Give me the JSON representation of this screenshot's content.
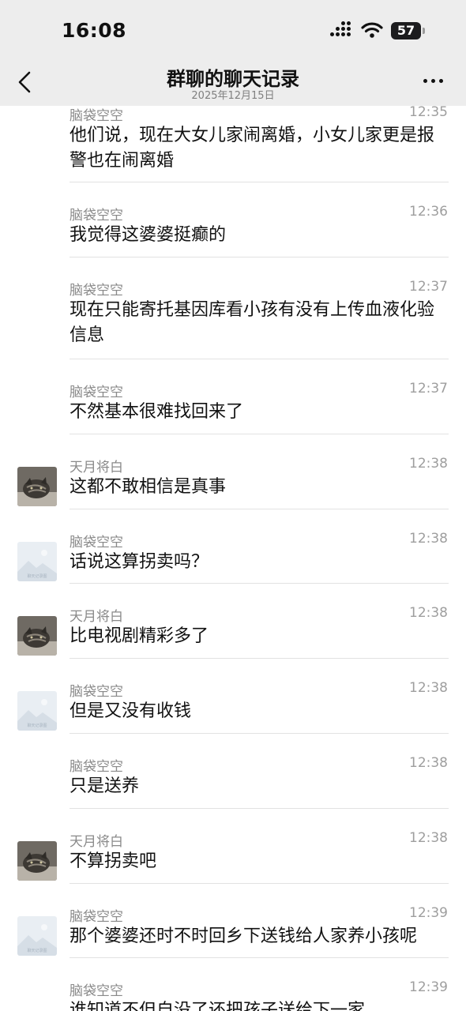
{
  "status_bar": {
    "time": "16:08",
    "battery": "57"
  },
  "header": {
    "title": "群聊的聊天记录",
    "date": "2025年12月15日"
  },
  "avatars": {
    "cat": {
      "icon": "cat-photo-avatar",
      "bg": "#4f4a44"
    },
    "placeholder": {
      "icon": "landscape-placeholder-avatar",
      "bg": "#e9eef3",
      "caption": "聊天记录图"
    }
  },
  "colors": {
    "header_bg": "#ededed",
    "divider": "#e2e2e2",
    "meta_text": "#8a8a8a"
  },
  "messages": [
    {
      "sender": "脑袋空空",
      "time": "12:35",
      "text": "他们说，现在大女儿家闹离婚，小女儿家更是报警也在闹离婚",
      "avatar": "none"
    },
    {
      "sender": "脑袋空空",
      "time": "12:36",
      "text": "我觉得这婆婆挺癫的",
      "avatar": "none"
    },
    {
      "sender": "脑袋空空",
      "time": "12:37",
      "text": "现在只能寄托基因库看小孩有没有上传血液化验信息",
      "avatar": "none"
    },
    {
      "sender": "脑袋空空",
      "time": "12:37",
      "text": "不然基本很难找回来了",
      "avatar": "none"
    },
    {
      "sender": "天月将白",
      "time": "12:38",
      "text": "这都不敢相信是真事",
      "avatar": "cat"
    },
    {
      "sender": "脑袋空空",
      "time": "12:38",
      "text": "话说这算拐卖吗？",
      "avatar": "placeholder"
    },
    {
      "sender": "天月将白",
      "time": "12:38",
      "text": "比电视剧精彩多了",
      "avatar": "cat"
    },
    {
      "sender": "脑袋空空",
      "time": "12:38",
      "text": "但是又没有收钱",
      "avatar": "placeholder"
    },
    {
      "sender": "脑袋空空",
      "time": "12:38",
      "text": "只是送养",
      "avatar": "none"
    },
    {
      "sender": "天月将白",
      "time": "12:38",
      "text": "不算拐卖吧",
      "avatar": "cat"
    },
    {
      "sender": "脑袋空空",
      "time": "12:39",
      "text": "那个婆婆还时不时回乡下送钱给人家养小孩呢",
      "avatar": "placeholder"
    },
    {
      "sender": "脑袋空空",
      "time": "12:39",
      "text": "谁知道不但自没了还把孩子送给下一家",
      "avatar": "none"
    }
  ]
}
